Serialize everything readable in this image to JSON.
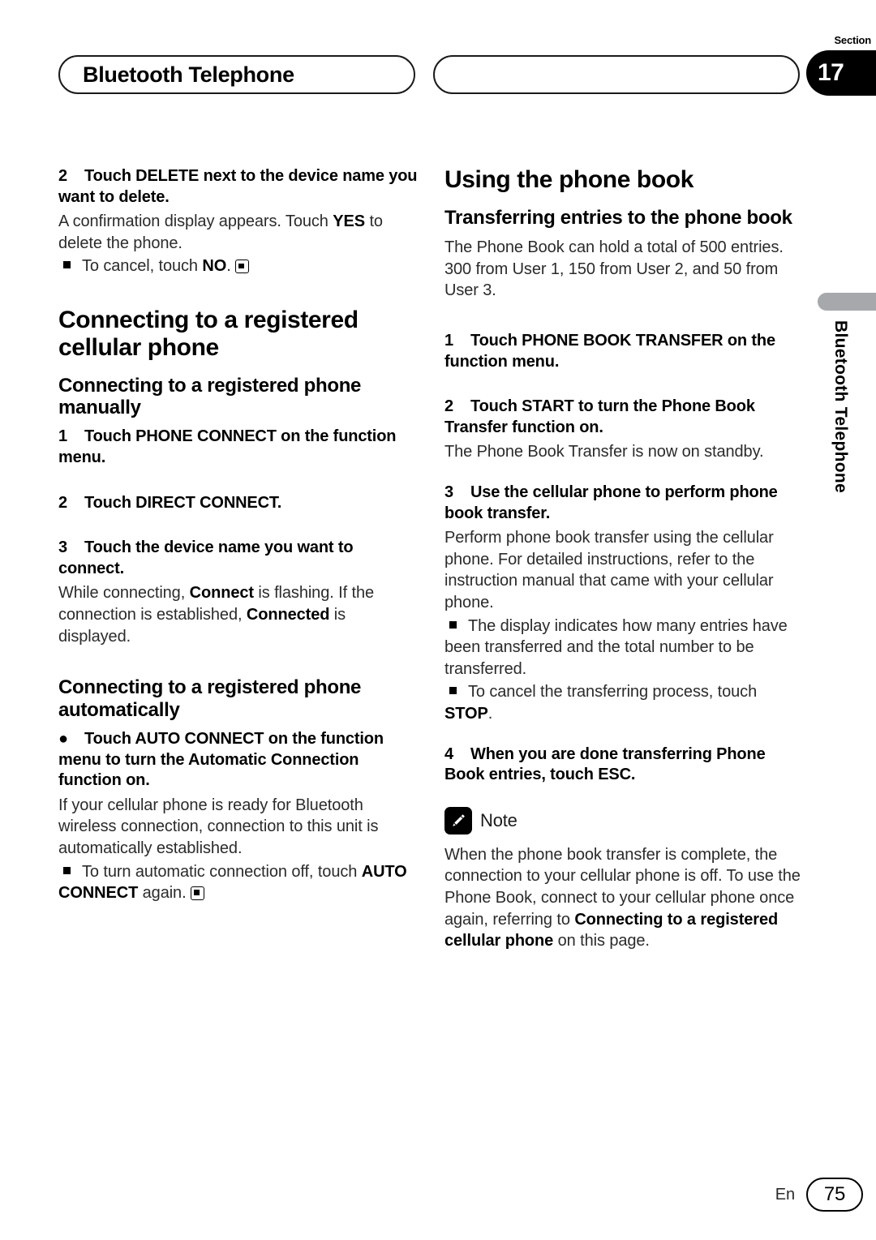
{
  "header": {
    "title": "Bluetooth Telephone",
    "section_label": "Section",
    "section_number": "17"
  },
  "side_tab": {
    "label": "Bluetooth Telephone",
    "bar_color": "#a6a8ab"
  },
  "left_column": {
    "step2_delete": {
      "number": "2",
      "title": "Touch DELETE next to the device name you want to delete.",
      "body_1": "A confirmation display appears. Touch ",
      "body_1_bold": "YES",
      "body_1_end": " to delete the phone.",
      "bullet_1": "To cancel, touch ",
      "bullet_1_bold": "NO",
      "bullet_1_end": "."
    },
    "heading_connecting": "Connecting to a registered cellular phone",
    "subheading_manually": "Connecting to a registered phone manually",
    "step1": {
      "number": "1",
      "title": "Touch PHONE CONNECT on the function menu."
    },
    "step2": {
      "number": "2",
      "title": "Touch DIRECT CONNECT."
    },
    "step3": {
      "number": "3",
      "title": "Touch the device name you want to connect.",
      "body_a": "While connecting, ",
      "body_b": "Connect",
      "body_c": " is flashing. If the connection is established, ",
      "body_d": "Connected",
      "body_e": " is displayed."
    },
    "subheading_automatically": "Connecting to a registered phone automatically",
    "bullet_step": {
      "marker": "●",
      "title": "Touch AUTO CONNECT on the function menu to turn the Automatic Connection function on.",
      "body": "If your cellular phone is ready for Bluetooth wireless connection, connection to this unit is automatically established.",
      "note_a": "To turn automatic connection off, touch ",
      "note_b": "AUTO CONNECT",
      "note_c": " again."
    }
  },
  "right_column": {
    "heading_using": "Using the phone book",
    "subheading_transferring": "Transferring entries to the phone book",
    "intro": "The Phone Book can hold a total of 500 entries. 300 from User 1, 150 from User 2, and 50 from User 3.",
    "step1": {
      "number": "1",
      "title": "Touch PHONE BOOK TRANSFER on the function menu."
    },
    "step2": {
      "number": "2",
      "title": "Touch START to turn the Phone Book Transfer function on.",
      "body": "The Phone Book Transfer is now on standby."
    },
    "step3": {
      "number": "3",
      "title": "Use the cellular phone to perform phone book transfer.",
      "body": "Perform phone book transfer using the cellular phone. For detailed instructions, refer to the instruction manual that came with your cellular phone.",
      "bullet_1": "The display indicates how many entries have been transferred and the total number to be transferred.",
      "bullet_2a": "To cancel the transferring process, touch ",
      "bullet_2b": "STOP",
      "bullet_2c": "."
    },
    "step4": {
      "number": "4",
      "title": "When you are done transferring Phone Book entries, touch ESC."
    },
    "note": {
      "icon": "pencil-icon",
      "label": "Note",
      "body_a": "When the phone book transfer is complete, the connection to your cellular phone is off. To use the Phone Book, connect to your cellular phone once again, referring to ",
      "body_b": "Connecting to a registered cellular phone",
      "body_c": " on this page."
    }
  },
  "footer": {
    "language": "En",
    "page_number": "75"
  }
}
